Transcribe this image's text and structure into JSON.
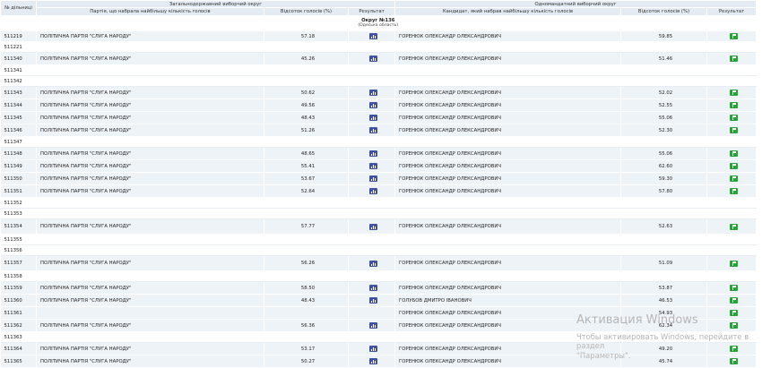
{
  "header": {
    "col_precinct": "№ дільниці",
    "group_national": "Загальнодержавний виборчий округ",
    "group_single": "Одномандатний виборчий округ",
    "col_party": "Партія, що набрала найбільшу кількість голосів",
    "col_party_pct": "Відсоток голосів (%)",
    "col_results": "Результат",
    "col_candidate": "Кандидат, який набрав найбільшу кількість голосів",
    "col_candidate_pct": "Відсоток голосів (%)",
    "col_results2": "Результат"
  },
  "district": {
    "title": "Округ №136",
    "region": "(Одеська область)"
  },
  "rows": [
    {
      "n": "511219",
      "party": "ПОЛІТИЧНА ПАРТІЯ \"СЛУГА НАРОДУ\"",
      "pp": "57.18",
      "cand": "ГОРЕНЮК ОЛЕКСАНДР ОЛЕКСАНДРОВИЧ",
      "cp": "59.85"
    },
    {
      "n": "511221",
      "party": "",
      "pp": "",
      "cand": "",
      "cp": ""
    },
    {
      "n": "511340",
      "party": "ПОЛІТИЧНА ПАРТІЯ \"СЛУГА НАРОДУ\"",
      "pp": "45.26",
      "cand": "ГОРЕНЮК ОЛЕКСАНДР ОЛЕКСАНДРОВИЧ",
      "cp": "51.46"
    },
    {
      "n": "511341",
      "party": "",
      "pp": "",
      "cand": "",
      "cp": ""
    },
    {
      "n": "511342",
      "party": "",
      "pp": "",
      "cand": "",
      "cp": ""
    },
    {
      "n": "511343",
      "party": "ПОЛІТИЧНА ПАРТІЯ \"СЛУГА НАРОДУ\"",
      "pp": "50.62",
      "cand": "ГОРЕНЮК ОЛЕКСАНДР ОЛЕКСАНДРОВИЧ",
      "cp": "52.02"
    },
    {
      "n": "511344",
      "party": "ПОЛІТИЧНА ПАРТІЯ \"СЛУГА НАРОДУ\"",
      "pp": "49.56",
      "cand": "ГОРЕНЮК ОЛЕКСАНДР ОЛЕКСАНДРОВИЧ",
      "cp": "52.55"
    },
    {
      "n": "511345",
      "party": "ПОЛІТИЧНА ПАРТІЯ \"СЛУГА НАРОДУ\"",
      "pp": "48.43",
      "cand": "ГОРЕНЮК ОЛЕКСАНДР ОЛЕКСАНДРОВИЧ",
      "cp": "55.06"
    },
    {
      "n": "511346",
      "party": "ПОЛІТИЧНА ПАРТІЯ \"СЛУГА НАРОДУ\"",
      "pp": "51.26",
      "cand": "ГОРЕНЮК ОЛЕКСАНДР ОЛЕКСАНДРОВИЧ",
      "cp": "52.30"
    },
    {
      "n": "511347",
      "party": "",
      "pp": "",
      "cand": "",
      "cp": ""
    },
    {
      "n": "511348",
      "party": "ПОЛІТИЧНА ПАРТІЯ \"СЛУГА НАРОДУ\"",
      "pp": "48.65",
      "cand": "ГОРЕНЮК ОЛЕКСАНДР ОЛЕКСАНДРОВИЧ",
      "cp": "55.06"
    },
    {
      "n": "511349",
      "party": "ПОЛІТИЧНА ПАРТІЯ \"СЛУГА НАРОДУ\"",
      "pp": "55.41",
      "cand": "ГОРЕНЮК ОЛЕКСАНДР ОЛЕКСАНДРОВИЧ",
      "cp": "62.60"
    },
    {
      "n": "511350",
      "party": "ПОЛІТИЧНА ПАРТІЯ \"СЛУГА НАРОДУ\"",
      "pp": "53.67",
      "cand": "ГОРЕНЮК ОЛЕКСАНДР ОЛЕКСАНДРОВИЧ",
      "cp": "59.30"
    },
    {
      "n": "511351",
      "party": "ПОЛІТИЧНА ПАРТІЯ \"СЛУГА НАРОДУ\"",
      "pp": "52.64",
      "cand": "ГОРЕНЮК ОЛЕКСАНДР ОЛЕКСАНДРОВИЧ",
      "cp": "57.80"
    },
    {
      "n": "511352",
      "party": "",
      "pp": "",
      "cand": "",
      "cp": ""
    },
    {
      "n": "511353",
      "party": "",
      "pp": "",
      "cand": "",
      "cp": ""
    },
    {
      "n": "511354",
      "party": "ПОЛІТИЧНА ПАРТІЯ \"СЛУГА НАРОДУ\"",
      "pp": "57.77",
      "cand": "ГОРЕНЮК ОЛЕКСАНДР ОЛЕКСАНДРОВИЧ",
      "cp": "52.63"
    },
    {
      "n": "511355",
      "party": "",
      "pp": "",
      "cand": "",
      "cp": ""
    },
    {
      "n": "511356",
      "party": "",
      "pp": "",
      "cand": "",
      "cp": ""
    },
    {
      "n": "511357",
      "party": "ПОЛІТИЧНА ПАРТІЯ \"СЛУГА НАРОДУ\"",
      "pp": "56.26",
      "cand": "ГОРЕНЮК ОЛЕКСАНДР ОЛЕКСАНДРОВИЧ",
      "cp": "51.09"
    },
    {
      "n": "511358",
      "party": "",
      "pp": "",
      "cand": "",
      "cp": ""
    },
    {
      "n": "511359",
      "party": "ПОЛІТИЧНА ПАРТІЯ \"СЛУГА НАРОДУ\"",
      "pp": "58.50",
      "cand": "ГОРЕНЮК ОЛЕКСАНДР ОЛЕКСАНДРОВИЧ",
      "cp": "53.87"
    },
    {
      "n": "511360",
      "party": "ПОЛІТИЧНА ПАРТІЯ \"СЛУГА НАРОДУ\"",
      "pp": "48.43",
      "cand": "ГОЛУБОВ ДМИТРО ІВАНОВИЧ",
      "cp": "46.53"
    },
    {
      "n": "511361",
      "party": "",
      "pp": "",
      "cand": "ГОРЕНЮК ОЛЕКСАНДР ОЛЕКСАНДРОВИЧ",
      "cp": "54.93"
    },
    {
      "n": "511362",
      "party": "ПОЛІТИЧНА ПАРТІЯ \"СЛУГА НАРОДУ\"",
      "pp": "56.36",
      "cand": "ГОРЕНЮК ОЛЕКСАНДР ОЛЕКСАНДРОВИЧ",
      "cp": "62.34"
    },
    {
      "n": "511363",
      "party": "",
      "pp": "",
      "cand": "",
      "cp": ""
    },
    {
      "n": "511364",
      "party": "ПОЛІТИЧНА ПАРТІЯ \"СЛУГА НАРОДУ\"",
      "pp": "53.17",
      "cand": "ГОРЕНЮК ОЛЕКСАНДР ОЛЕКСАНДРОВИЧ",
      "cp": "49.20"
    },
    {
      "n": "511365",
      "party": "ПОЛІТИЧНА ПАРТІЯ \"СЛУГА НАРОДУ\"",
      "pp": "50.27",
      "cand": "ГОРЕНЮК ОЛЕКСАНДР ОЛЕКСАНДРОВИЧ",
      "cp": "45.74"
    }
  ],
  "watermark": {
    "title": "Активация Windows",
    "line1": "Чтобы активировать Windows, перейдите в раздел",
    "line2": "\"Параметры\"."
  },
  "colors": {
    "header_bg": "#e5ebf2",
    "row_bg": "#eef3f8",
    "chart_btn": "#3f51a6",
    "go_btn": "#2f9e3c"
  },
  "icons": {
    "chart": "bar-chart-icon",
    "go": "flag-icon"
  }
}
